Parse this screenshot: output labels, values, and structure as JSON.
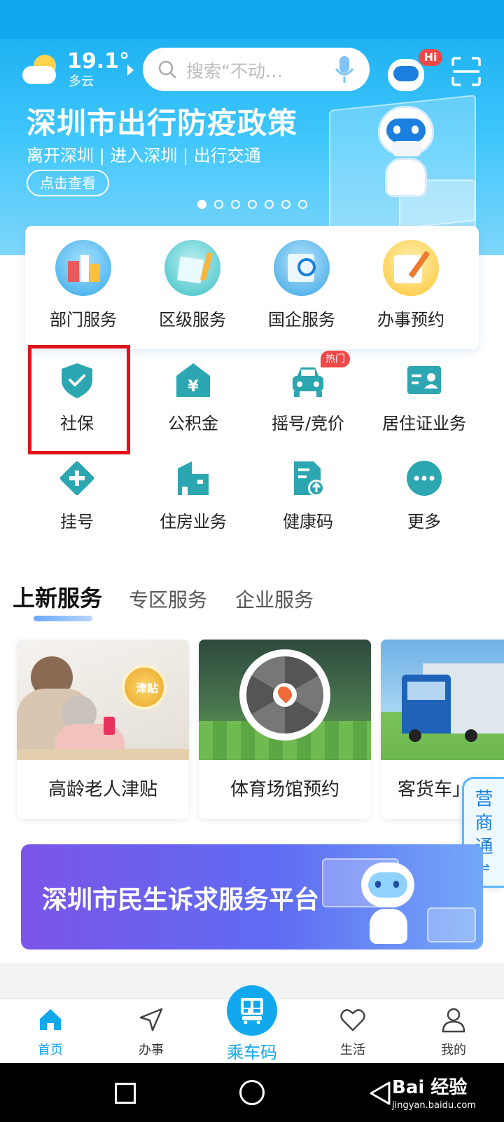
{
  "weather": {
    "temp": "19.1°",
    "desc": "多云"
  },
  "search": {
    "placeholder": "搜索“不动…"
  },
  "header": {
    "badge": "Hi"
  },
  "banner": {
    "title": "深圳市出行防疫政策",
    "subtitle": "离开深圳 | 进入深圳 | 出行交通",
    "button": "点击查看",
    "dots_total": 7,
    "active_dot": 0
  },
  "quick_services": [
    {
      "label": "部门服务",
      "icon": "department-icon"
    },
    {
      "label": "区级服务",
      "icon": "district-icon"
    },
    {
      "label": "国企服务",
      "icon": "soe-icon"
    },
    {
      "label": "办事预约",
      "icon": "appointment-icon"
    }
  ],
  "grid": [
    {
      "label": "社保",
      "icon": "shield-check-icon"
    },
    {
      "label": "公积金",
      "icon": "house-yuan-icon"
    },
    {
      "label": "摇号/竞价",
      "icon": "car-icon",
      "badge": "热门"
    },
    {
      "label": "居住证业务",
      "icon": "id-card-icon"
    },
    {
      "label": "挂号",
      "icon": "medical-cross-icon"
    },
    {
      "label": "住房业务",
      "icon": "buildings-icon"
    },
    {
      "label": "健康码",
      "icon": "health-code-icon"
    },
    {
      "label": "更多",
      "icon": "more-dots-icon"
    }
  ],
  "tabs": [
    "上新服务",
    "专区服务",
    "企业服务"
  ],
  "active_tab": 0,
  "new_services": [
    {
      "label": "高龄老人津贴",
      "img_text": "津贴"
    },
    {
      "label": "体育场馆预约"
    },
    {
      "label": "客货车」"
    }
  ],
  "side_tab": {
    "label": "营商通"
  },
  "promo": {
    "title": "深圳市民生诉求服务平台"
  },
  "nav": {
    "home": "首页",
    "tasks": "办事",
    "ride": "乘车码",
    "life": "生活",
    "mine": "我的"
  },
  "watermark": {
    "text": "Bai 经验",
    "sub": "jingyan.baidu.com"
  },
  "colors": {
    "accent": "#11a8ee",
    "teal": "#2ca6b0",
    "highlight": "#e0121d",
    "badge": "#f04848"
  }
}
